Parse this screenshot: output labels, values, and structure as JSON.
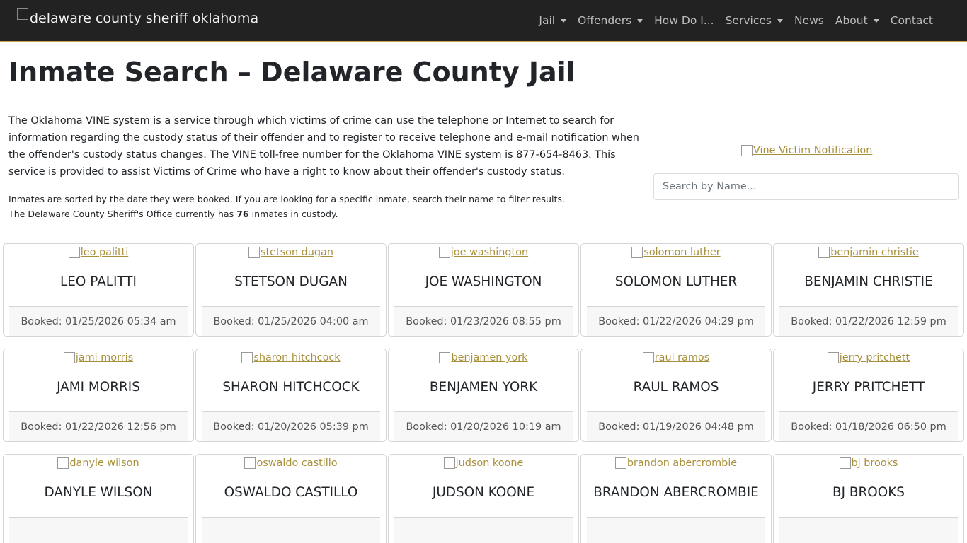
{
  "brand": {
    "alt_text": "delaware county sheriff oklahoma"
  },
  "nav": {
    "items": [
      {
        "label": "Jail",
        "dropdown": true
      },
      {
        "label": "Offenders",
        "dropdown": true
      },
      {
        "label": "How Do I...",
        "dropdown": false
      },
      {
        "label": "Services",
        "dropdown": true
      },
      {
        "label": "News",
        "dropdown": false
      },
      {
        "label": "About",
        "dropdown": true
      },
      {
        "label": "Contact",
        "dropdown": false
      }
    ]
  },
  "page": {
    "title": "Inmate Search – Delaware County Jail",
    "intro": "The Oklahoma VINE system is a service through which victims of crime can use the telephone or Internet to search for information regarding the custody status of their offender and to register to receive telephone and e-mail notification when the offender's custody status changes. The VINE toll-free number for the Oklahoma VINE system is 877-654-8463. This service is provided to assist Victims of Crime who have a right to know about their offender's custody status.",
    "note_line1": "Inmates are sorted by the date they were booked. If you are looking for a specific inmate, search their name to filter results.",
    "note_line2_prefix": "The Delaware County Sheriff's Office currently has ",
    "inmate_count": "76",
    "note_line2_suffix": " inmates in custody."
  },
  "vine": {
    "alt_text": "Vine Victim Notification"
  },
  "search": {
    "placeholder": "Search by Name...",
    "value": ""
  },
  "inmates": [
    {
      "photo_alt": "leo palitti",
      "name": "LEO PALITTI",
      "booked": "Booked: 01/25/2026 05:34 am"
    },
    {
      "photo_alt": "stetson dugan",
      "name": "STETSON DUGAN",
      "booked": "Booked: 01/25/2026 04:00 am"
    },
    {
      "photo_alt": "joe washington",
      "name": "JOE WASHINGTON",
      "booked": "Booked: 01/23/2026 08:55 pm"
    },
    {
      "photo_alt": "solomon luther",
      "name": "SOLOMON LUTHER",
      "booked": "Booked: 01/22/2026 04:29 pm"
    },
    {
      "photo_alt": "benjamin christie",
      "name": "BENJAMIN CHRISTIE",
      "booked": "Booked: 01/22/2026 12:59 pm"
    },
    {
      "photo_alt": "jami morris",
      "name": "JAMI MORRIS",
      "booked": "Booked: 01/22/2026 12:56 pm"
    },
    {
      "photo_alt": "sharon hitchcock",
      "name": "SHARON HITCHCOCK",
      "booked": "Booked: 01/20/2026 05:39 pm"
    },
    {
      "photo_alt": "benjamen york",
      "name": "BENJAMEN YORK",
      "booked": "Booked: 01/20/2026 10:19 am"
    },
    {
      "photo_alt": "raul ramos",
      "name": "RAUL RAMOS",
      "booked": "Booked: 01/19/2026 04:48 pm"
    },
    {
      "photo_alt": "jerry pritchett",
      "name": "JERRY PRITCHETT",
      "booked": "Booked: 01/18/2026 06:50 pm"
    },
    {
      "photo_alt": "danyle wilson",
      "name": "DANYLE WILSON",
      "booked": ""
    },
    {
      "photo_alt": "oswaldo castillo",
      "name": "OSWALDO CASTILLO",
      "booked": ""
    },
    {
      "photo_alt": "judson koone",
      "name": "JUDSON KOONE",
      "booked": ""
    },
    {
      "photo_alt": "brandon abercrombie",
      "name": "BRANDON ABERCROMBIE",
      "booked": ""
    },
    {
      "photo_alt": "bj brooks",
      "name": "BJ BROOKS",
      "booked": ""
    }
  ],
  "colors": {
    "navbar": "#222222",
    "accent": "#c8a24b",
    "link": "#a8913c"
  }
}
